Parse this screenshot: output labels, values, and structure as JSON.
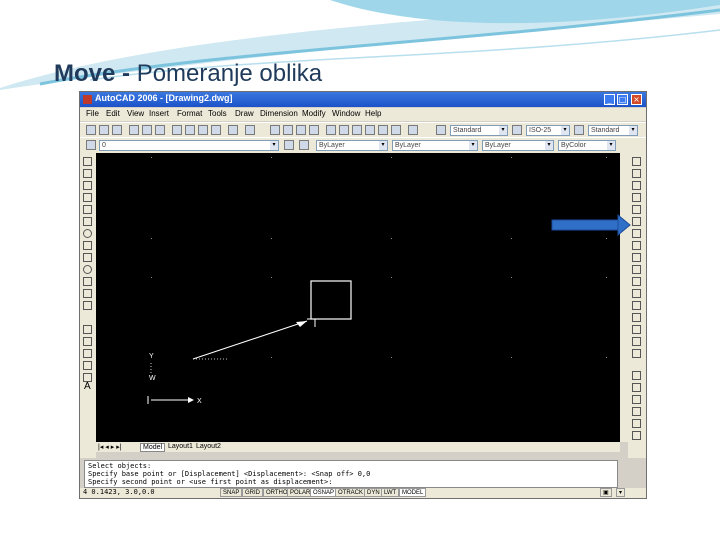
{
  "slide": {
    "title_bold": "Move",
    "title_sep": " - ",
    "title_rest": "Pomeranje oblika"
  },
  "window": {
    "title": "AutoCAD 2006 - [Drawing2.dwg]",
    "controls": {
      "minimize": "_",
      "maximize": "□",
      "close": "×"
    }
  },
  "menu": [
    "File",
    "Edit",
    "View",
    "Insert",
    "Format",
    "Tools",
    "Draw",
    "Dimension",
    "Modify",
    "Window",
    "Help"
  ],
  "toolbar": {
    "text_style": "Standard",
    "dim_style": "ISO-25",
    "table_style": "Standard",
    "layer": "0",
    "color": "ByLayer",
    "linetype": "ByLayer",
    "lineweight": "ByLayer",
    "plot_style": "ByColor"
  },
  "left_toolbar": {
    "text_tool": "A"
  },
  "canvas": {
    "ucs_y": "Y",
    "ucs_x": "X",
    "ucs_w": "W"
  },
  "layout_tabs": [
    "Model",
    "Layout1",
    "Layout2"
  ],
  "command_lines": [
    "Select objects:",
    "Specify base point or [Displacement] <Displacement>: <Snap off> 0,0",
    "Specify second point or <use first point as displacement>:"
  ],
  "status": {
    "coords": "4 0.1423, 3.0,0.0",
    "buttons": [
      "SNAP",
      "GRID",
      "ORTHO",
      "POLAR",
      "OSNAP",
      "OTRACK",
      "DYN",
      "LWT",
      "MODEL"
    ],
    "active_buttons": [
      "OSNAP",
      "MODEL"
    ]
  },
  "colors": {
    "accent": "#2f6fc8",
    "title": "#1f3a5a",
    "canvas": "#000000"
  }
}
